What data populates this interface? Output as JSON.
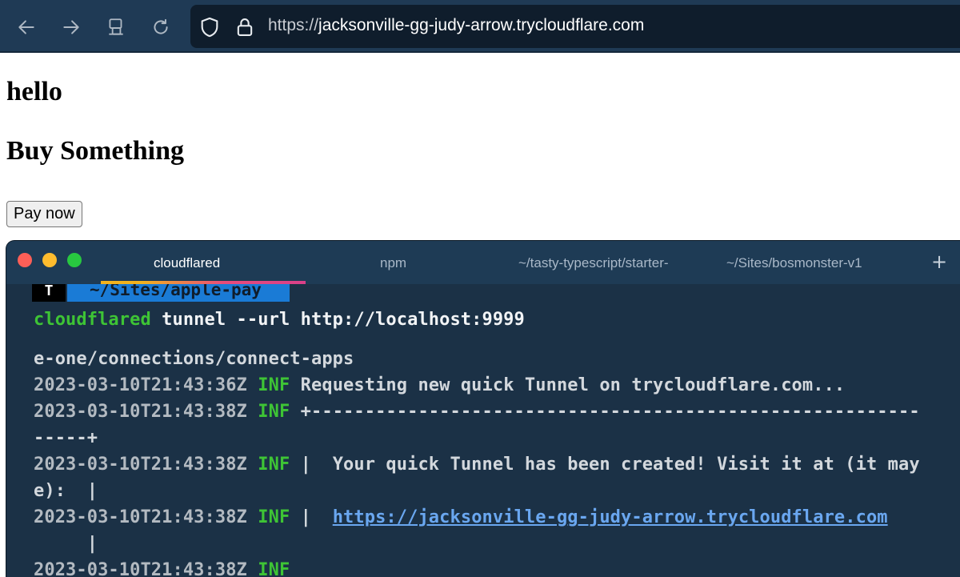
{
  "browser": {
    "url_scheme": "https://",
    "url_host": "jacksonville-gg-judy-arrow.trycloudflare.com",
    "icons": [
      "back-icon",
      "forward-icon",
      "screen-share-icon",
      "reload-icon",
      "shield-icon",
      "lock-icon"
    ]
  },
  "page": {
    "heading1": "hello",
    "heading2": "Buy Something",
    "pay_button": "Pay now"
  },
  "terminal": {
    "tabs": [
      "cloudflared",
      "npm",
      "~/tasty-typescript/starter-",
      "~/Sites/bosmonster-v1"
    ],
    "new_tab": "+",
    "prompt_letter": "T",
    "prompt_dir": "~/Sites/apple-pay",
    "command_name": "cloudflared",
    "command_args": " tunnel --url http://localhost:9999",
    "lines": {
      "l1": "e-one/connections/connect-apps",
      "ts1": "2023-03-10T21:43:36Z",
      "inf": "INF",
      "msg1": " Requesting new quick Tunnel on trycloudflare.com...",
      "ts2": "2023-03-10T21:43:38Z",
      "msg2": " +---------------------------------------------------------",
      "l4": "-----+",
      "ts3": "2023-03-10T21:43:38Z",
      "msg3": " |  Your quick Tunnel has been created! Visit it at (it may",
      "l6": "e):  |",
      "ts4": "2023-03-10T21:43:38Z",
      "msg4_pre": " |  ",
      "msg4_link": "https://jacksonville-gg-judy-arrow.trycloudflare.com",
      "l8": "     |",
      "ts5": "2023-03-10T21:43:38Z"
    },
    "colors": {
      "bg": "#1b3146",
      "green": "#3ec435",
      "link": "#6aa7f0",
      "prompt_blue": "#1a7bd6"
    }
  }
}
